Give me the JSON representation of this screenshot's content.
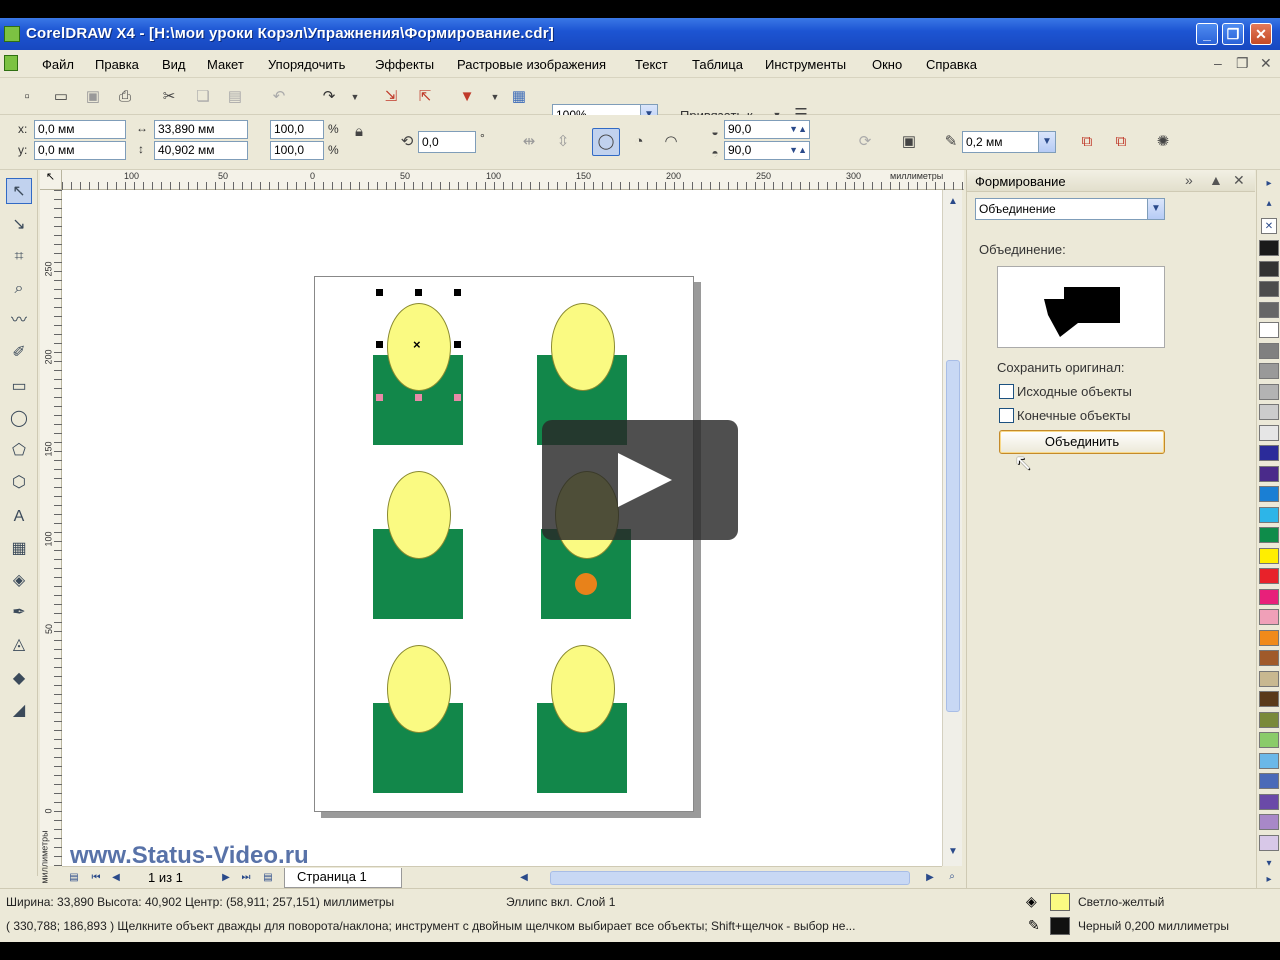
{
  "window": {
    "title": "CorelDRAW X4 - [H:\\мои уроки Корэл\\Упражнения\\Формирование.cdr]",
    "min_label": "_",
    "restore_label": "❐",
    "close_label": "✕"
  },
  "menu": {
    "items": [
      "Файл",
      "Правка",
      "Вид",
      "Макет",
      "Упорядочить",
      "Эффекты",
      "Растровые изображения",
      "Текст",
      "Таблица",
      "Инструменты",
      "Окно",
      "Справка"
    ],
    "mdi": [
      "–",
      "❐",
      "✕"
    ]
  },
  "toolbar1": {
    "zoom": "100%",
    "snap_label": "Привязать к"
  },
  "toolbar2": {
    "x_label": "x:",
    "x_value": "0,0 мм",
    "y_label": "y:",
    "y_value": "0,0 мм",
    "width_value": "33,890 мм",
    "height_value": "40,902 мм",
    "scale_x": "100,0",
    "scale_y": "100,0",
    "percent": "%",
    "rotation": "0,0",
    "degree": "°",
    "start_angle": "90,0",
    "end_angle": "90,0",
    "outline_width": "0,2 мм"
  },
  "ruler": {
    "h_ticks": [
      "100",
      "50",
      "0",
      "50",
      "100",
      "150",
      "200",
      "250",
      "300"
    ],
    "h_unit": "миллиметры",
    "v_ticks": [
      "250",
      "200",
      "150",
      "100",
      "50",
      "0"
    ],
    "v_unit": "миллиметры",
    "corner": "↖"
  },
  "canvas": {
    "watermark": "www.Status-Video.ru"
  },
  "pagenav": {
    "counter": "1 из 1",
    "tab": "Страница 1"
  },
  "docker": {
    "title": "Формирование",
    "mode": "Объединение",
    "section_label": "Объединение:",
    "keep_label": "Сохранить оригинал:",
    "source_label": "Исходные объекты",
    "target_label": "Конечные объекты",
    "apply_label": "Объединить"
  },
  "palette": {
    "colors": [
      "#1a1a1a",
      "#333333",
      "#4d4d4d",
      "#666666",
      "#ffffff",
      "#808080",
      "#999999",
      "#b3b3b3",
      "#cccccc",
      "#e6e6e6",
      "#2b2b9a",
      "#4a2a8a",
      "#1a7fd4",
      "#2db5e8",
      "#0e8c4a",
      "#ffee00",
      "#e8222a",
      "#e8207a",
      "#f0a0b8",
      "#f08a1a",
      "#a05a2a",
      "#c8b890",
      "#5a3a1a",
      "#7a8a3a",
      "#8acb6a",
      "#6ab8e8",
      "#4a6ab8",
      "#6a4aa8",
      "#a888c8",
      "#d8c8e8"
    ]
  },
  "status": {
    "line1": "Ширина: 33,890  Высота: 40,902  Центр: (58,911; 257,151)  миллиметры",
    "layer": "Эллипс вкл. Слой 1",
    "line2": "( 330,788; 186,893 )    Щелкните объект дважды для поворота/наклона; инструмент с двойным щелчком выбирает все объекты; Shift+щелчок - выбор не...",
    "fill_name": "Светло-желтый",
    "fill_color": "#fafa82",
    "outline_name": "Черный  0,200 миллиметры",
    "outline_color": "#111111"
  },
  "colors": {
    "shape_green": "#12874a",
    "shape_yellow": "#fafa82",
    "orange_dot": "#e8821a"
  }
}
